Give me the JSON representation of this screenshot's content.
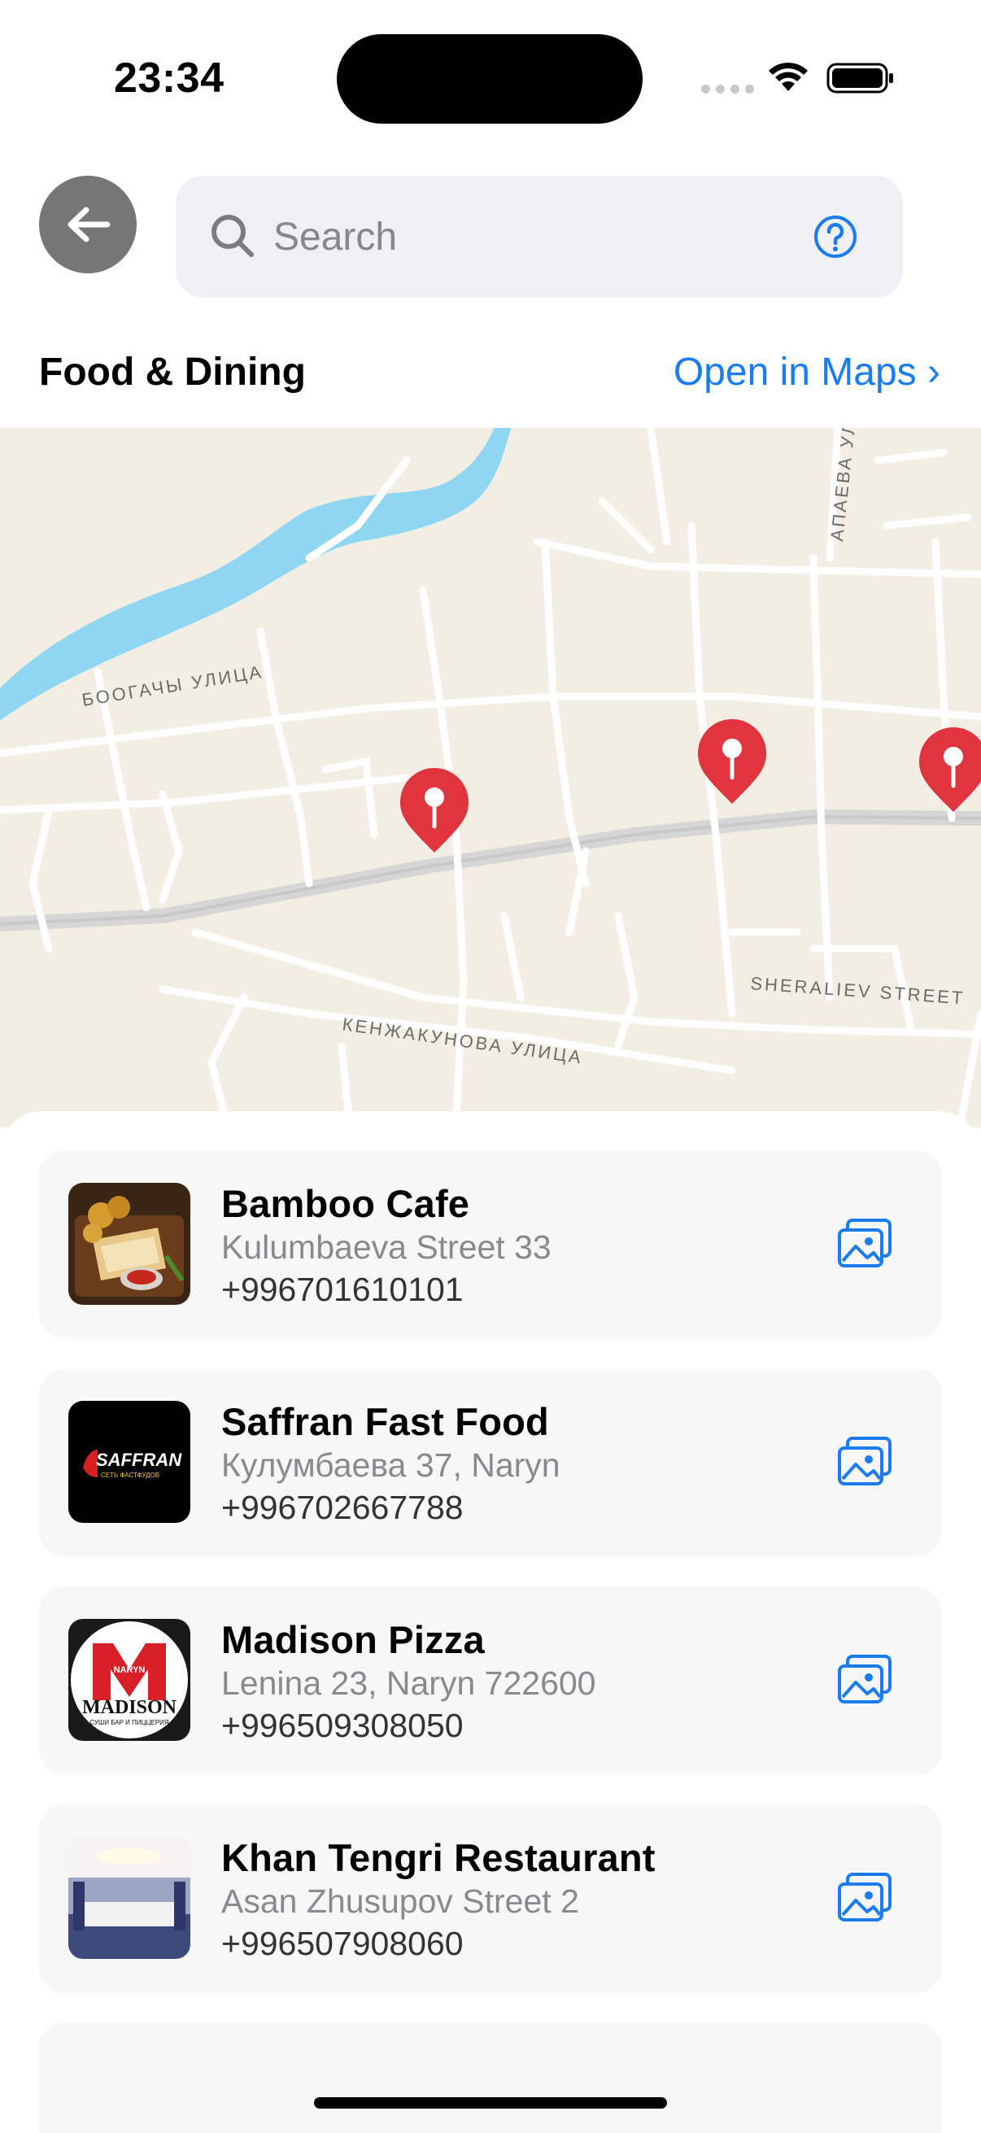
{
  "status_bar": {
    "time": "23:34"
  },
  "header": {
    "search_placeholder": "Search",
    "section_title": "Food & Dining",
    "open_maps_label": "Open in Maps ›"
  },
  "map": {
    "street_labels": [
      "БООГАЧЫ УЛИЦА",
      "SHERALIEV STREET",
      "КЕНЖАКУНОВА УЛИЦА",
      "АПАЕВА УЛ"
    ],
    "pin_count": 3
  },
  "places": [
    {
      "name": "Bamboo Cafe",
      "address": "Kulumbaeva Street 33",
      "phone": "+996701610101",
      "thumb_text": ""
    },
    {
      "name": "Saffran Fast Food",
      "address": "Кулумбаева 37, Naryn",
      "phone": "+996702667788",
      "thumb_text": "SAFFRAN",
      "thumb_subtext": "СЕТЬ ФАСТФУДОВ"
    },
    {
      "name": "Madison Pizza",
      "address": "Lenina 23, Naryn 722600",
      "phone": "+996509308050",
      "thumb_text": "MADISON",
      "thumb_subtext": "СУШИ БАР И ПИЦЦЕРИЯ",
      "thumb_top": "NARYN"
    },
    {
      "name": "Khan Tengri Restaurant",
      "address": "Asan Zhusupov Street 2",
      "phone": "+996507908060",
      "thumb_text": ""
    }
  ],
  "colors": {
    "accent": "#1a7cf0",
    "map_land": "#f3eee3",
    "map_water": "#8fd6f3",
    "pin": "#e0343f"
  },
  "icons": [
    "back-arrow-icon",
    "search-icon",
    "help-icon",
    "gallery-icon",
    "wifi-icon",
    "battery-icon"
  ]
}
